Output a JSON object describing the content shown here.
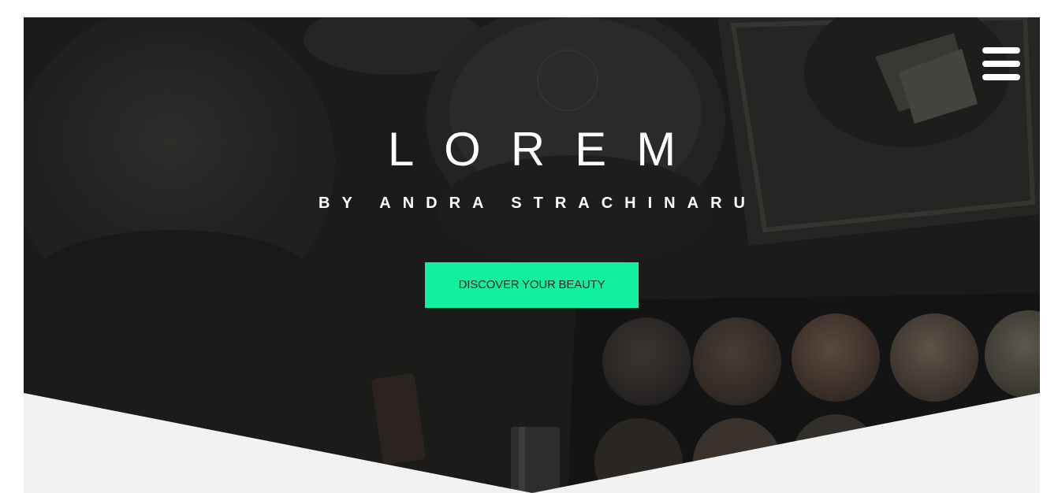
{
  "hero": {
    "title": "LOREM",
    "subtitle": "BY ANDRA STRACHINARU",
    "cta_label": "DISCOVER YOUR BEAUTY",
    "background_image": "makeup-flatlay-photo"
  },
  "nav": {
    "menu_icon": "hamburger-menu-icon"
  },
  "colors": {
    "accent": "#11efa0",
    "overlay": "#1a1a1a",
    "light_section": "#f2f2f2",
    "text_light": "#ffffff",
    "button_text": "#2a2a2a"
  }
}
